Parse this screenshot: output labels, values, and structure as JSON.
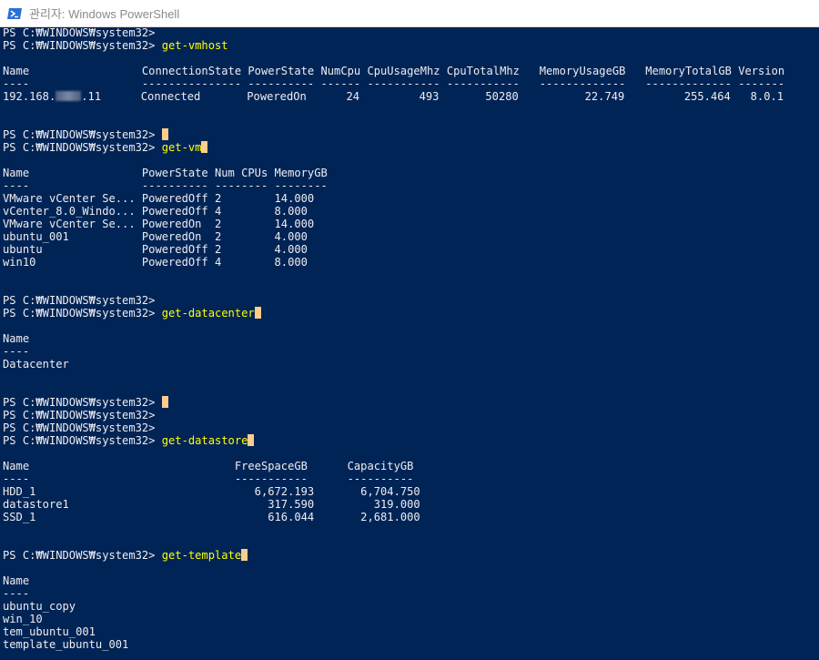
{
  "window": {
    "title": "관리자: Windows PowerShell",
    "colors": {
      "background": "#012456",
      "text": "#eeedf0",
      "command": "#ffff00",
      "cursor": "#fecd8a"
    }
  },
  "prompt": "PS C:₩WINDOWS₩system32> ",
  "commands": {
    "vmhost": "get-vmhost",
    "vm": "get-vm",
    "datacenter": "get-datacenter",
    "datastore": "get-datastore",
    "template": "get-template"
  },
  "vmhost": {
    "header": "Name                 ConnectionState PowerState NumCpu CpuUsageMhz CpuTotalMhz   MemoryUsageGB   MemoryTotalGB Version",
    "separator": "----                 --------------- ---------- ------ ----------- -----------   -------------   ------------- -------",
    "row_name_start": "192.168.",
    "row_name_end": ".11",
    "row_rest": "Connected       PoweredOn      24         493       50280          22.749         255.464   8.0.1"
  },
  "vm": {
    "header": "Name                 PowerState Num CPUs MemoryGB",
    "separator": "----                 ---------- -------- --------",
    "rows": [
      "VMware vCenter Se... PoweredOff 2        14.000",
      "vCenter_8.0_Windo... PoweredOff 4        8.000",
      "VMware vCenter Se... PoweredOn  2        14.000",
      "ubuntu_001           PoweredOn  2        4.000",
      "ubuntu               PoweredOff 2        4.000",
      "win10                PoweredOff 4        8.000"
    ]
  },
  "datacenter": {
    "header": "Name",
    "separator": "----",
    "rows": [
      "Datacenter"
    ]
  },
  "datastore": {
    "header": "Name                               FreeSpaceGB      CapacityGB",
    "separator": "----                               -----------      ----------",
    "rows": [
      "HDD_1                                 6,672.193       6,704.750",
      "datastore1                              317.590         319.000",
      "SSD_1                                   616.044       2,681.000"
    ]
  },
  "template": {
    "header": "Name",
    "separator": "----",
    "rows": [
      "ubuntu_copy",
      "win_10",
      "tem_ubuntu_001",
      "template_ubuntu_001"
    ]
  }
}
